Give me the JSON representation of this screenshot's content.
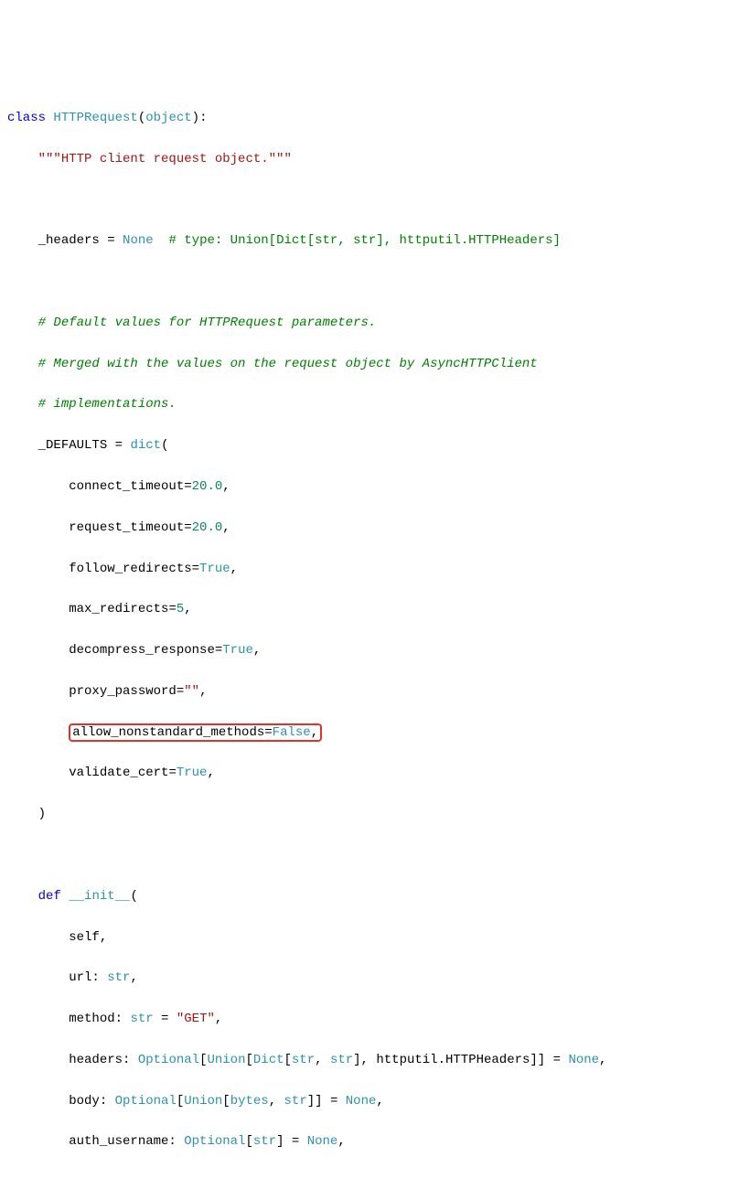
{
  "code": {
    "class_kw": "class",
    "class_name": "HTTPRequest",
    "object": "object",
    "docstring": "\"\"\"HTTP client request object.\"\"\"",
    "headers_var": "_headers",
    "eq": " = ",
    "none": "None",
    "headers_comment": "# type: Union[Dict[str, str], httputil.HTTPHeaders]",
    "comment1": "# Default values for HTTPRequest parameters.",
    "comment2": "# Merged with the values on the request object by AsyncHTTPClient",
    "comment3": "# implementations.",
    "defaults_var": "_DEFAULTS",
    "dict": "dict",
    "kwargs": {
      "connect_timeout": {
        "name": "connect_timeout",
        "val": "20.0"
      },
      "request_timeout": {
        "name": "request_timeout",
        "val": "20.0"
      },
      "follow_redirects": {
        "name": "follow_redirects",
        "val": "True"
      },
      "max_redirects": {
        "name": "max_redirects",
        "val": "5"
      },
      "decompress_response": {
        "name": "decompress_response",
        "val": "True"
      },
      "proxy_password": {
        "name": "proxy_password",
        "val": "\"\""
      },
      "allow_nonstandard_methods": {
        "name": "allow_nonstandard_methods",
        "val": "False"
      },
      "validate_cert": {
        "name": "validate_cert",
        "val": "True"
      }
    },
    "def_kw": "def",
    "init_name": "__init__",
    "params": {
      "self": "self",
      "url": "url: ",
      "url_type": "str",
      "method": "method: ",
      "method_type": "str",
      "method_eq": " = ",
      "method_default": "\"GET\"",
      "headers": "headers: ",
      "headers_type_pre": "Optional",
      "headers_type_mid1": "Union",
      "headers_type_mid2": "Dict",
      "headers_type_str": "str",
      "headers_httputil": "httputil.HTTPHeaders",
      "headers_none": " = ",
      "headers_none_val": "None",
      "body": "body: ",
      "body_type_pre": "Optional",
      "body_type_mid": "Union",
      "body_bytes": "bytes",
      "body_str": "str",
      "body_none": " = ",
      "body_none_val": "None",
      "auth": "auth_username: ",
      "auth_type_pre": "Optional",
      "auth_str": "str",
      "auth_none": " = ",
      "auth_none_val": "None"
    }
  }
}
